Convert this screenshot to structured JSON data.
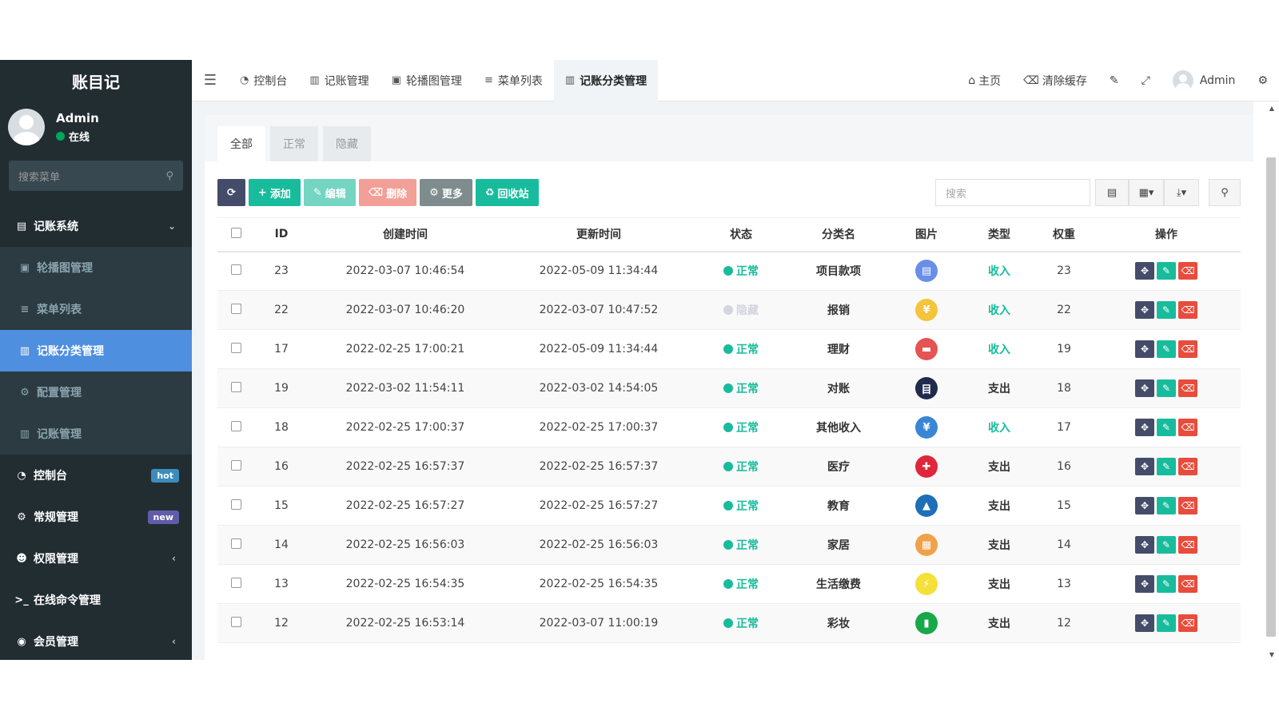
{
  "sidebar": {
    "brand": "账目记",
    "user": {
      "name": "Admin",
      "status": "在线"
    },
    "search_placeholder": "搜索菜单",
    "group": {
      "label": "记账系统",
      "icon": "book-icon"
    },
    "subitems": [
      {
        "label": "轮播图管理",
        "icon": "image-icon",
        "active": false
      },
      {
        "label": "菜单列表",
        "icon": "list-icon",
        "active": false
      },
      {
        "label": "记账分类管理",
        "icon": "file-icon",
        "active": true
      },
      {
        "label": "配置管理",
        "icon": "gear-icon",
        "active": false
      },
      {
        "label": "记账管理",
        "icon": "file-icon",
        "active": false
      }
    ],
    "items": [
      {
        "label": "控制台",
        "icon": "dashboard-icon",
        "badge": "hot"
      },
      {
        "label": "常规管理",
        "icon": "cogs-icon",
        "badge": "new"
      },
      {
        "label": "权限管理",
        "icon": "users-icon",
        "badge": ""
      },
      {
        "label": "在线命令管理",
        "icon": "terminal-icon",
        "badge": ""
      },
      {
        "label": "会员管理",
        "icon": "user-circle-icon",
        "badge": ""
      }
    ]
  },
  "topbar": {
    "tabs": [
      {
        "label": "控制台",
        "icon": "dashboard-icon",
        "active": false
      },
      {
        "label": "记账管理",
        "icon": "file-icon",
        "active": false
      },
      {
        "label": "轮播图管理",
        "icon": "image-icon",
        "active": false
      },
      {
        "label": "菜单列表",
        "icon": "list-icon",
        "active": false
      },
      {
        "label": "记账分类管理",
        "icon": "file-icon",
        "active": true
      }
    ],
    "home": "主页",
    "clear_cache": "清除缓存",
    "user": "Admin"
  },
  "panel": {
    "tabs": [
      "全部",
      "正常",
      "隐藏"
    ],
    "buttons": {
      "add": "添加",
      "edit": "编辑",
      "delete": "删除",
      "more": "更多",
      "recycle": "回收站"
    },
    "search_placeholder": "搜索"
  },
  "table": {
    "headers": [
      "ID",
      "创建时间",
      "更新时间",
      "状态",
      "分类名",
      "图片",
      "类型",
      "权重",
      "操作"
    ],
    "rows": [
      {
        "id": "23",
        "created": "2022-03-07 10:46:54",
        "updated": "2022-05-09 11:34:44",
        "status": "正常",
        "status_color": "#18bc9c",
        "name": "项目款项",
        "icon": "document-icon",
        "icon_color": "#6a8fe8",
        "icon_glyph": "▤",
        "type": "收入",
        "weight": "23"
      },
      {
        "id": "22",
        "created": "2022-03-07 10:46:20",
        "updated": "2022-03-07 10:47:52",
        "status": "隐藏",
        "status_color": "#d2d6de",
        "name": "报销",
        "icon": "receipt-icon",
        "icon_color": "#f4c43d",
        "icon_glyph": "¥",
        "type": "收入",
        "weight": "22"
      },
      {
        "id": "17",
        "created": "2022-02-25 17:00:21",
        "updated": "2022-05-09 11:34:44",
        "status": "正常",
        "status_color": "#18bc9c",
        "name": "理财",
        "icon": "wallet-icon",
        "icon_color": "#e55353",
        "icon_glyph": "▬",
        "type": "收入",
        "weight": "19"
      },
      {
        "id": "19",
        "created": "2022-03-02 11:54:11",
        "updated": "2022-03-02 14:54:05",
        "status": "正常",
        "status_color": "#18bc9c",
        "name": "对账",
        "icon": "ledger-icon",
        "icon_color": "#1f2b4d",
        "icon_glyph": "目",
        "type": "支出",
        "weight": "18"
      },
      {
        "id": "18",
        "created": "2022-02-25 17:00:37",
        "updated": "2022-02-25 17:00:37",
        "status": "正常",
        "status_color": "#18bc9c",
        "name": "其他收入",
        "icon": "yen-icon",
        "icon_color": "#3a86d6",
        "icon_glyph": "¥",
        "type": "收入",
        "weight": "17"
      },
      {
        "id": "16",
        "created": "2022-02-25 16:57:37",
        "updated": "2022-02-25 16:57:37",
        "status": "正常",
        "status_color": "#18bc9c",
        "name": "医疗",
        "icon": "medical-cross-icon",
        "icon_color": "#e0263a",
        "icon_glyph": "✚",
        "type": "支出",
        "weight": "16"
      },
      {
        "id": "15",
        "created": "2022-02-25 16:57:27",
        "updated": "2022-02-25 16:57:27",
        "status": "正常",
        "status_color": "#18bc9c",
        "name": "教育",
        "icon": "graduation-cap-icon",
        "icon_color": "#1d6fb8",
        "icon_glyph": "▲",
        "type": "支出",
        "weight": "15"
      },
      {
        "id": "14",
        "created": "2022-02-25 16:56:03",
        "updated": "2022-02-25 16:56:03",
        "status": "正常",
        "status_color": "#18bc9c",
        "name": "家居",
        "icon": "cabinet-icon",
        "icon_color": "#f0a24a",
        "icon_glyph": "▦",
        "type": "支出",
        "weight": "14"
      },
      {
        "id": "13",
        "created": "2022-02-25 16:54:35",
        "updated": "2022-02-25 16:54:35",
        "status": "正常",
        "status_color": "#18bc9c",
        "name": "生活缴费",
        "icon": "lightning-icon",
        "icon_color": "#f5e03a",
        "icon_glyph": "⚡",
        "type": "支出",
        "weight": "13"
      },
      {
        "id": "12",
        "created": "2022-02-25 16:53:14",
        "updated": "2022-03-07 11:00:19",
        "status": "正常",
        "status_color": "#18bc9c",
        "name": "彩妆",
        "icon": "lipstick-icon",
        "icon_color": "#18a84a",
        "icon_glyph": "▮",
        "type": "支出",
        "weight": "12"
      }
    ]
  }
}
